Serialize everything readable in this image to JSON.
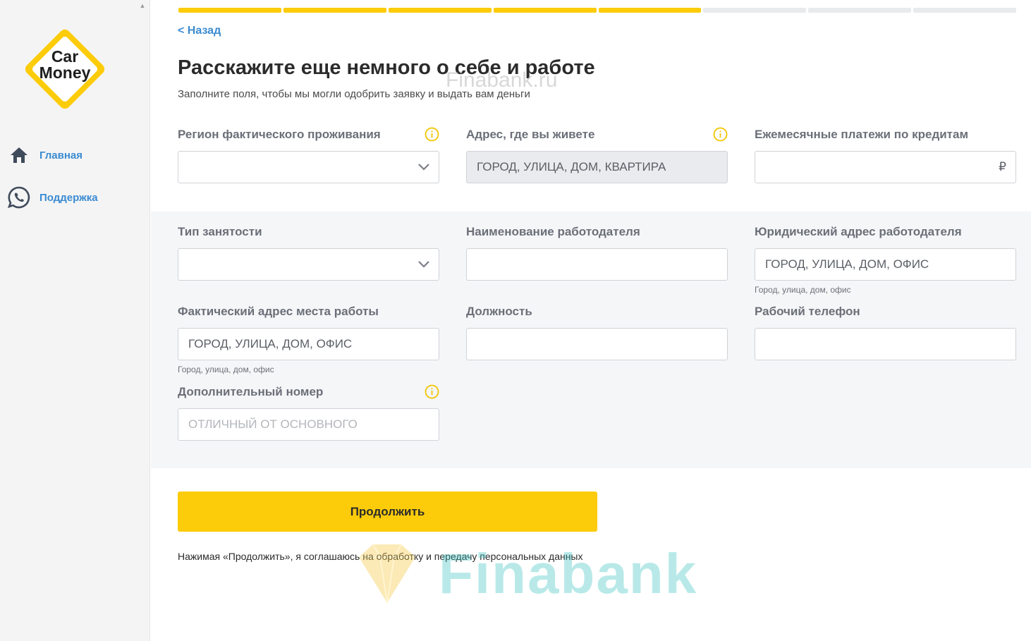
{
  "sidebar": {
    "logo_line1": "Car",
    "logo_line2": "Money",
    "nav": [
      {
        "label": "Главная",
        "icon": "home-icon"
      },
      {
        "label": "Поддержка",
        "icon": "whatsapp-icon"
      }
    ]
  },
  "progress": {
    "total_steps": 8,
    "completed_steps": 5
  },
  "header": {
    "back_label": "< Назад",
    "title": "Расскажите еще немного о себе и работе",
    "subtitle": "Заполните поля, чтобы мы могли одобрить заявку и выдать вам деньги"
  },
  "watermark": {
    "top": "Finabank.ru",
    "bottom": "Finabank"
  },
  "fields": {
    "region": {
      "label": "Регион фактического проживания",
      "value": ""
    },
    "address": {
      "label": "Адрес, где вы живете",
      "placeholder": "ГОРОД, УЛИЦА, ДОМ, КВАРТИРА"
    },
    "monthly_payments": {
      "label": "Ежемесячные платежи по кредитам",
      "currency": "₽"
    },
    "employment_type": {
      "label": "Тип занятости",
      "value": ""
    },
    "employer_name": {
      "label": "Наименование работодателя",
      "value": ""
    },
    "employer_legal_address": {
      "label": "Юридический адрес работодателя",
      "placeholder": "ГОРОД, УЛИЦА, ДОМ, ОФИС",
      "hint": "Город, улица, дом, офис"
    },
    "work_address": {
      "label": "Фактический адрес места работы",
      "placeholder": "ГОРОД, УЛИЦА, ДОМ, ОФИС",
      "hint": "Город, улица, дом, офис"
    },
    "position": {
      "label": "Должность",
      "value": ""
    },
    "work_phone": {
      "label": "Рабочий телефон",
      "value": ""
    },
    "extra_phone": {
      "label": "Дополнительный номер",
      "placeholder": "ОТЛИЧНЫЙ ОТ ОСНОВНОГО"
    }
  },
  "actions": {
    "continue_label": "Продолжить",
    "agreement": "Нажимая «Продолжить», я соглашаюсь на обработку и передачу персональных данных"
  },
  "colors": {
    "accent": "#fccc0a",
    "link": "#3a8bd1",
    "band": "#f5f6f8"
  }
}
